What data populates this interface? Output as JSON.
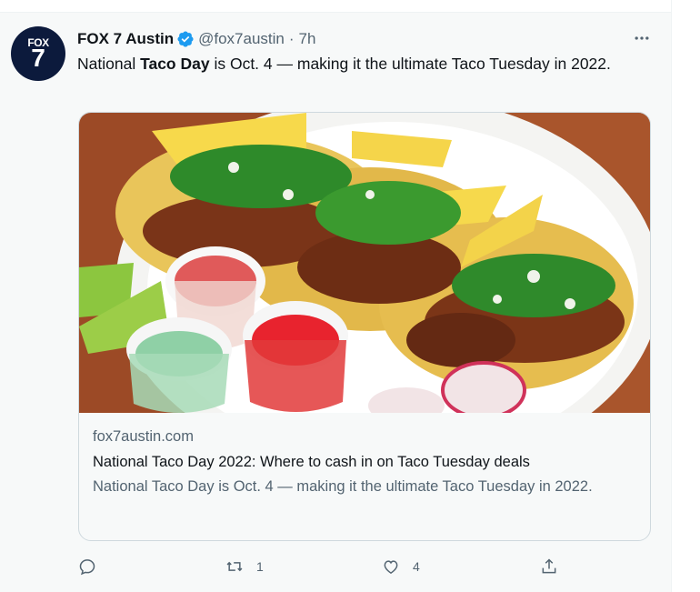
{
  "tweet": {
    "display_name": "FOX 7 Austin",
    "handle": "@fox7austin",
    "separator": "·",
    "time": "7h",
    "more_label": "•••",
    "avatar": {
      "line1": "FOX",
      "line2": "7"
    },
    "text": {
      "before": "National ",
      "bold": "Taco Day",
      "after": " is Oct. 4 — making it the ultimate Taco Tuesday in 2022."
    }
  },
  "card": {
    "image_alt": "Plate of tacos with salsa cups and lime wedges",
    "domain": "fox7austin.com",
    "headline": "National Taco Day 2022: Where to cash in on Taco Tuesday deals",
    "description": "National Taco Day is Oct. 4 — making it the ultimate Taco Tuesday in 2022."
  },
  "actions": {
    "reply": {
      "icon": "reply-icon",
      "count": ""
    },
    "retweet": {
      "icon": "retweet-icon",
      "count": "1"
    },
    "like": {
      "icon": "heart-icon",
      "count": "4"
    },
    "share": {
      "icon": "share-icon"
    }
  },
  "colors": {
    "background": "#f7f9f9",
    "text": "#0f1419",
    "secondary": "#536471",
    "verified": "#1d9bf0",
    "border": "#cfd9de"
  }
}
